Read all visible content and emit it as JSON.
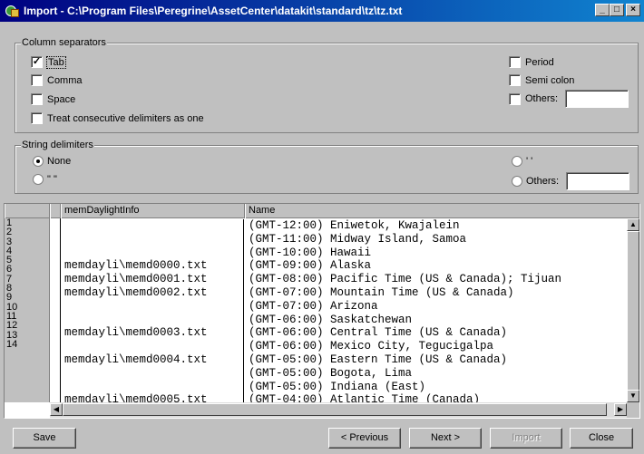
{
  "window": {
    "title": "Import - C:\\Program Files\\Peregrine\\AssetCenter\\datakit\\standard\\tz\\tz.txt",
    "controls": {
      "minimize": "_",
      "maximize": "□",
      "close": "×"
    }
  },
  "column_separators": {
    "label": "Column separators",
    "tab": {
      "label": "Tab",
      "checked": true
    },
    "comma": {
      "label": "Comma",
      "checked": false
    },
    "space": {
      "label": "Space",
      "checked": false
    },
    "consecutive": {
      "label": "Treat consecutive delimiters as one",
      "checked": false
    },
    "period": {
      "label": "Period",
      "checked": false
    },
    "semicolon": {
      "label": "Semi colon",
      "checked": false
    },
    "others": {
      "label": "Others:",
      "checked": false,
      "value": ""
    }
  },
  "string_delimiters": {
    "label": "String delimiters",
    "none": {
      "label": "None",
      "selected": true
    },
    "double_quote": {
      "label": "\" \"",
      "selected": false
    },
    "single_quote": {
      "label": "' '",
      "selected": false
    },
    "others": {
      "label": "Others:",
      "selected": false,
      "value": ""
    }
  },
  "grid": {
    "columns": [
      "memDaylightInfo",
      "Name"
    ],
    "row_numbers": [
      "1",
      "2",
      "3",
      "4",
      "5",
      "6",
      "7",
      "8",
      "9",
      "10",
      "11",
      "12",
      "13",
      "14"
    ],
    "rows": [
      {
        "c1": "",
        "c2": "(GMT-12:00) Eniwetok, Kwajalein"
      },
      {
        "c1": "",
        "c2": "(GMT-11:00) Midway Island, Samoa"
      },
      {
        "c1": "",
        "c2": "(GMT-10:00) Hawaii"
      },
      {
        "c1": "memdayli\\memd0000.txt",
        "c2": "(GMT-09:00) Alaska"
      },
      {
        "c1": "memdayli\\memd0001.txt",
        "c2": "(GMT-08:00) Pacific Time (US & Canada); Tijuan"
      },
      {
        "c1": "memdayli\\memd0002.txt",
        "c2": "(GMT-07:00) Mountain Time (US & Canada)"
      },
      {
        "c1": "",
        "c2": "(GMT-07:00) Arizona"
      },
      {
        "c1": "",
        "c2": "(GMT-06:00) Saskatchewan"
      },
      {
        "c1": "memdayli\\memd0003.txt",
        "c2": "(GMT-06:00) Central Time (US & Canada)"
      },
      {
        "c1": "",
        "c2": "(GMT-06:00) Mexico City, Tegucigalpa"
      },
      {
        "c1": "memdayli\\memd0004.txt",
        "c2": "(GMT-05:00) Eastern Time (US & Canada)"
      },
      {
        "c1": "",
        "c2": "(GMT-05:00) Bogota, Lima"
      },
      {
        "c1": "",
        "c2": "(GMT-05:00) Indiana (East)"
      },
      {
        "c1": "memdayli\\memd0005.txt",
        "c2": "(GMT-04:00) Atlantic Time (Canada)"
      }
    ]
  },
  "buttons": {
    "save": "Save",
    "previous": "< Previous",
    "next": "Next >",
    "import": "Import",
    "close": "Close"
  }
}
